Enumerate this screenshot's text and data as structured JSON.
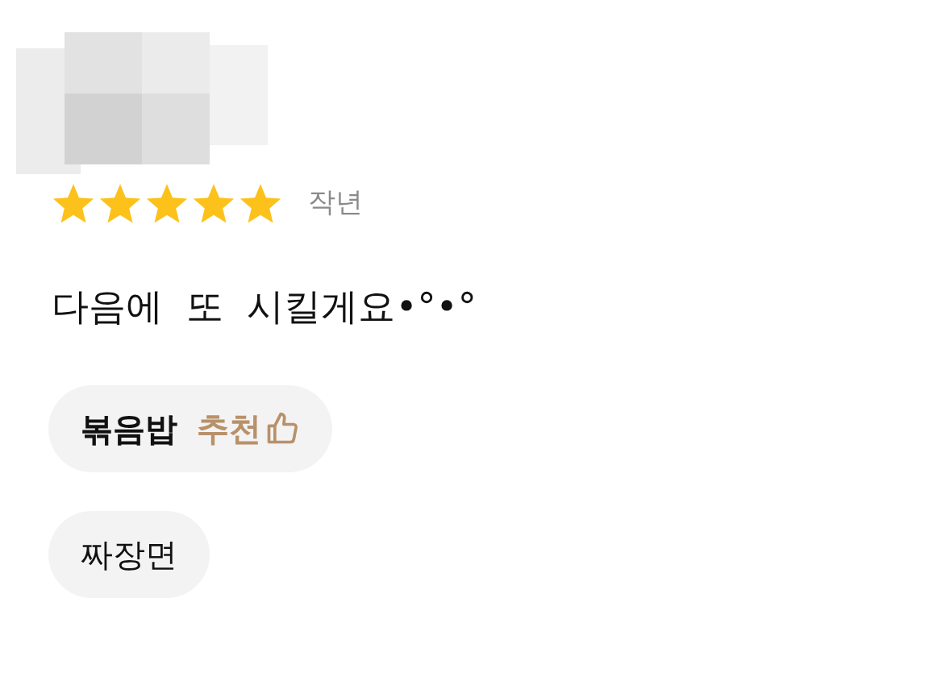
{
  "review": {
    "stars": 5,
    "date": "작년",
    "text": "다음에  또  시킬게요•°•°"
  },
  "menu_items": [
    {
      "label": "볶음밥",
      "recommended": true,
      "badge": "추천"
    },
    {
      "label": "짜장면",
      "recommended": false
    }
  ]
}
